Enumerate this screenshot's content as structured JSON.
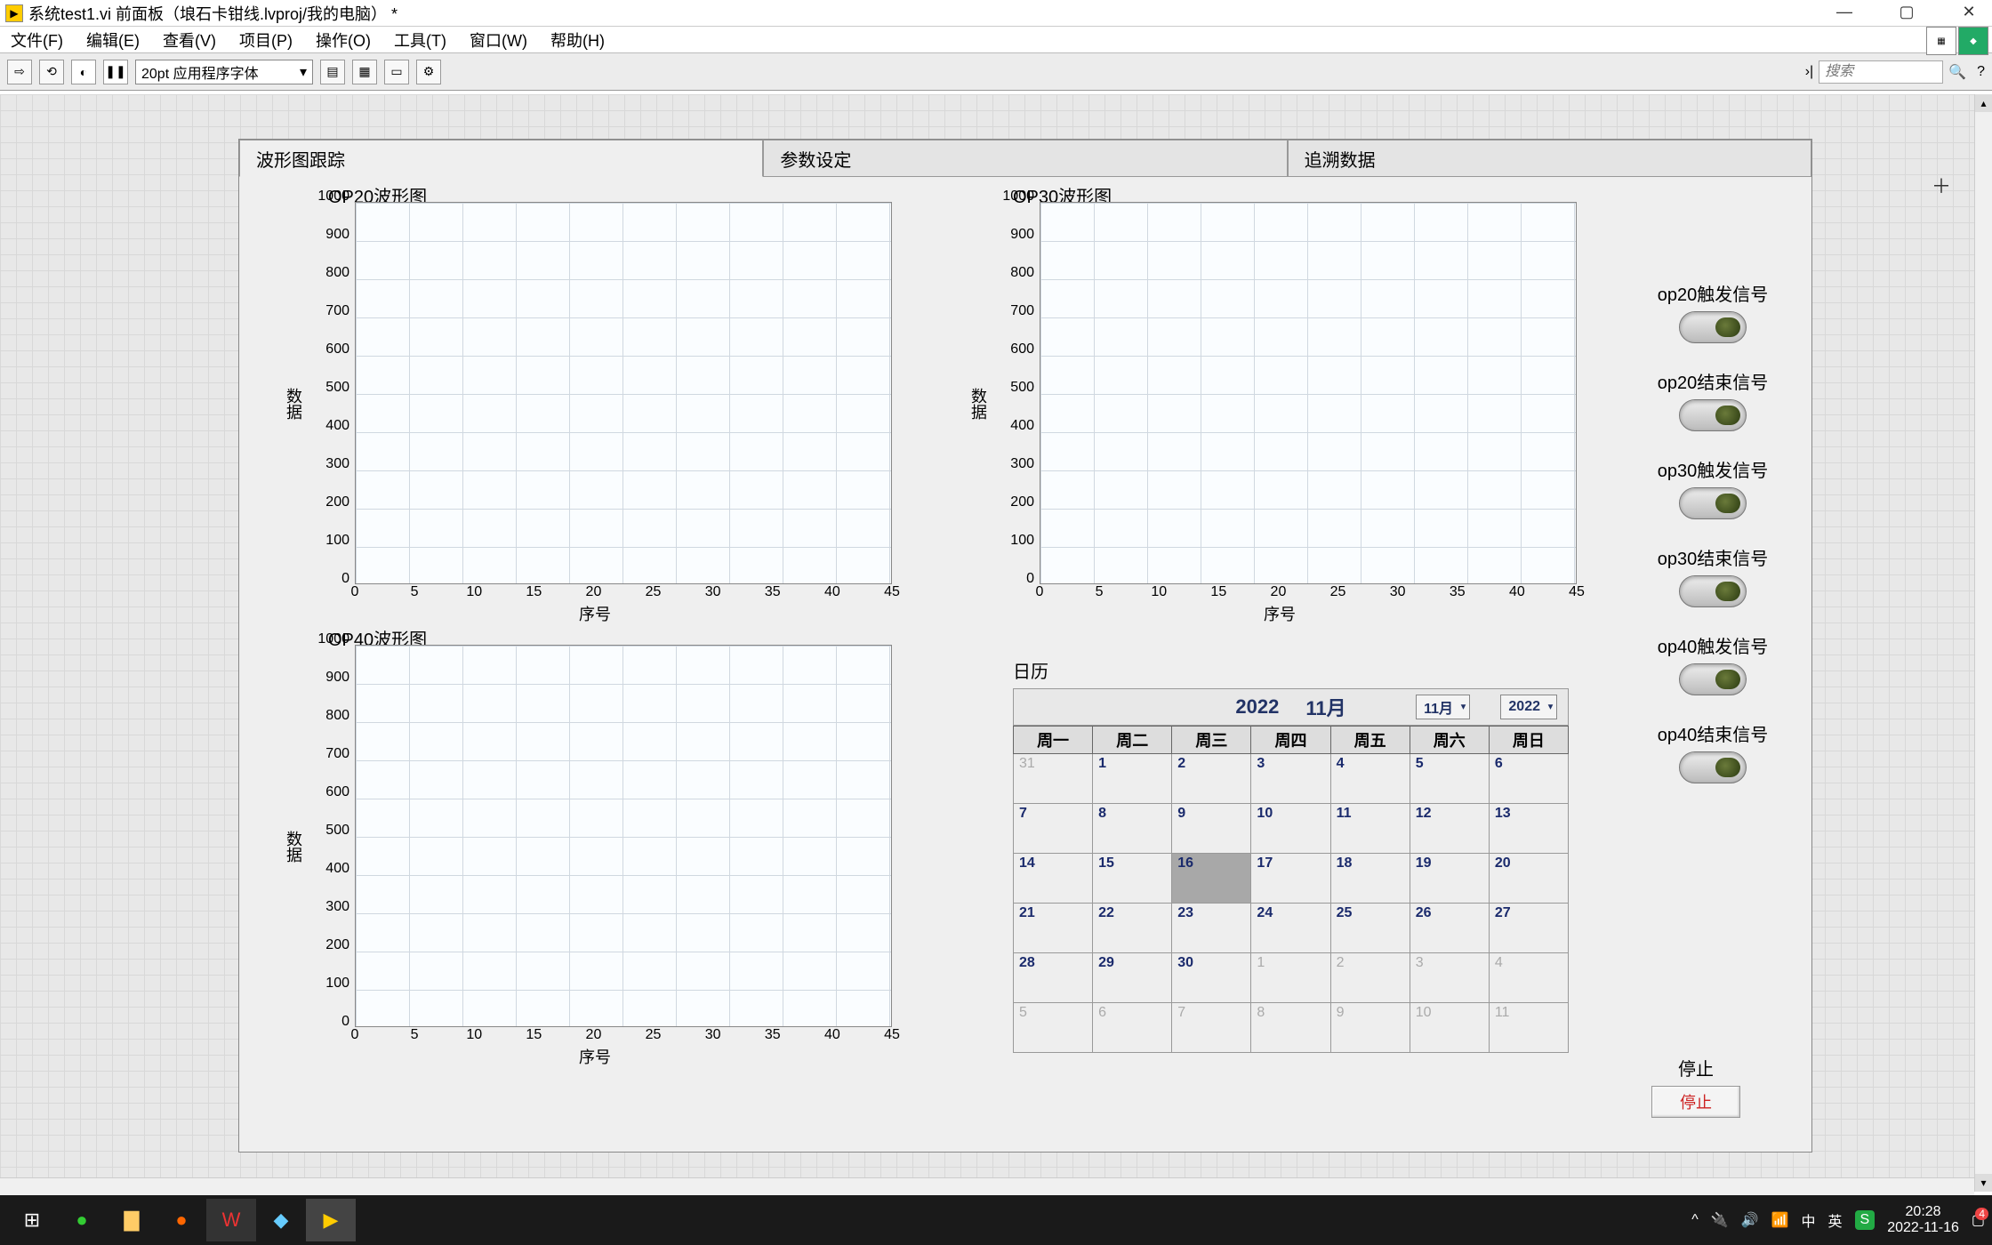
{
  "titlebar": {
    "title": "系统test1.vi 前面板（埌石卡钳线.lvproj/我的电脑） *"
  },
  "menu": {
    "file": "文件(F)",
    "edit": "编辑(E)",
    "view": "查看(V)",
    "project": "项目(P)",
    "operate": "操作(O)",
    "tools": "工具(T)",
    "window": "窗口(W)",
    "help": "帮助(H)"
  },
  "toolbar": {
    "font": "20pt 应用程序字体",
    "search_placeholder": "搜索"
  },
  "tabs": {
    "t1": "波形图跟踪",
    "t2": "参数设定",
    "t3": "追溯数据"
  },
  "charts": {
    "op20": {
      "title": "OP20波形图",
      "ylabel": "数据",
      "xlabel": "序号"
    },
    "op30": {
      "title": "OP30波形图",
      "ylabel": "数据",
      "xlabel": "序号"
    },
    "op40": {
      "title": "OP40波形图",
      "ylabel": "数据",
      "xlabel": "序号"
    }
  },
  "chart_data": [
    {
      "type": "line",
      "id": "op20",
      "title": "OP20波形图",
      "xlabel": "序号",
      "ylabel": "数据",
      "xlim": [
        0,
        45
      ],
      "ylim": [
        0,
        1000
      ],
      "xticks": [
        0,
        5,
        10,
        15,
        20,
        25,
        30,
        35,
        40,
        45
      ],
      "yticks": [
        0,
        100,
        200,
        300,
        400,
        500,
        600,
        700,
        800,
        900,
        1000
      ],
      "series": []
    },
    {
      "type": "line",
      "id": "op30",
      "title": "OP30波形图",
      "xlabel": "序号",
      "ylabel": "数据",
      "xlim": [
        0,
        45
      ],
      "ylim": [
        0,
        1000
      ],
      "xticks": [
        0,
        5,
        10,
        15,
        20,
        25,
        30,
        35,
        40,
        45
      ],
      "yticks": [
        0,
        100,
        200,
        300,
        400,
        500,
        600,
        700,
        800,
        900,
        1000
      ],
      "series": []
    },
    {
      "type": "line",
      "id": "op40",
      "title": "OP40波形图",
      "xlabel": "序号",
      "ylabel": "数据",
      "xlim": [
        0,
        45
      ],
      "ylim": [
        0,
        1000
      ],
      "xticks": [
        0,
        5,
        10,
        15,
        20,
        25,
        30,
        35,
        40,
        45
      ],
      "yticks": [
        0,
        100,
        200,
        300,
        400,
        500,
        600,
        700,
        800,
        900,
        1000
      ],
      "series": []
    }
  ],
  "calendar": {
    "label": "日历",
    "year": "2022",
    "month": "11月",
    "month_sel": "11月",
    "year_sel": "2022",
    "dow": [
      "周一",
      "周二",
      "周三",
      "周四",
      "周五",
      "周六",
      "周日"
    ],
    "weeks": [
      [
        {
          "d": "31",
          "g": true
        },
        {
          "d": "1"
        },
        {
          "d": "2"
        },
        {
          "d": "3"
        },
        {
          "d": "4"
        },
        {
          "d": "5"
        },
        {
          "d": "6"
        }
      ],
      [
        {
          "d": "7"
        },
        {
          "d": "8"
        },
        {
          "d": "9"
        },
        {
          "d": "10"
        },
        {
          "d": "11"
        },
        {
          "d": "12"
        },
        {
          "d": "13"
        }
      ],
      [
        {
          "d": "14"
        },
        {
          "d": "15"
        },
        {
          "d": "16",
          "t": true
        },
        {
          "d": "17"
        },
        {
          "d": "18"
        },
        {
          "d": "19"
        },
        {
          "d": "20"
        }
      ],
      [
        {
          "d": "21"
        },
        {
          "d": "22"
        },
        {
          "d": "23"
        },
        {
          "d": "24"
        },
        {
          "d": "25"
        },
        {
          "d": "26"
        },
        {
          "d": "27"
        }
      ],
      [
        {
          "d": "28"
        },
        {
          "d": "29"
        },
        {
          "d": "30"
        },
        {
          "d": "1",
          "g": true
        },
        {
          "d": "2",
          "g": true
        },
        {
          "d": "3",
          "g": true
        },
        {
          "d": "4",
          "g": true
        }
      ],
      [
        {
          "d": "5",
          "g": true
        },
        {
          "d": "6",
          "g": true
        },
        {
          "d": "7",
          "g": true
        },
        {
          "d": "8",
          "g": true
        },
        {
          "d": "9",
          "g": true
        },
        {
          "d": "10",
          "g": true
        },
        {
          "d": "11",
          "g": true
        }
      ]
    ]
  },
  "leds": {
    "l1": "op20触发信号",
    "l2": "op20结束信号",
    "l3": "op30触发信号",
    "l4": "op30结束信号",
    "l5": "op40触发信号",
    "l6": "op40结束信号"
  },
  "stop": {
    "label": "停止",
    "button": "停止"
  },
  "projbar": {
    "text": "埌石卡钳线.lvproj/我的电脑"
  },
  "tray": {
    "time": "20:28",
    "date": "2022-11-16",
    "ime": "英",
    "notif": "4"
  }
}
